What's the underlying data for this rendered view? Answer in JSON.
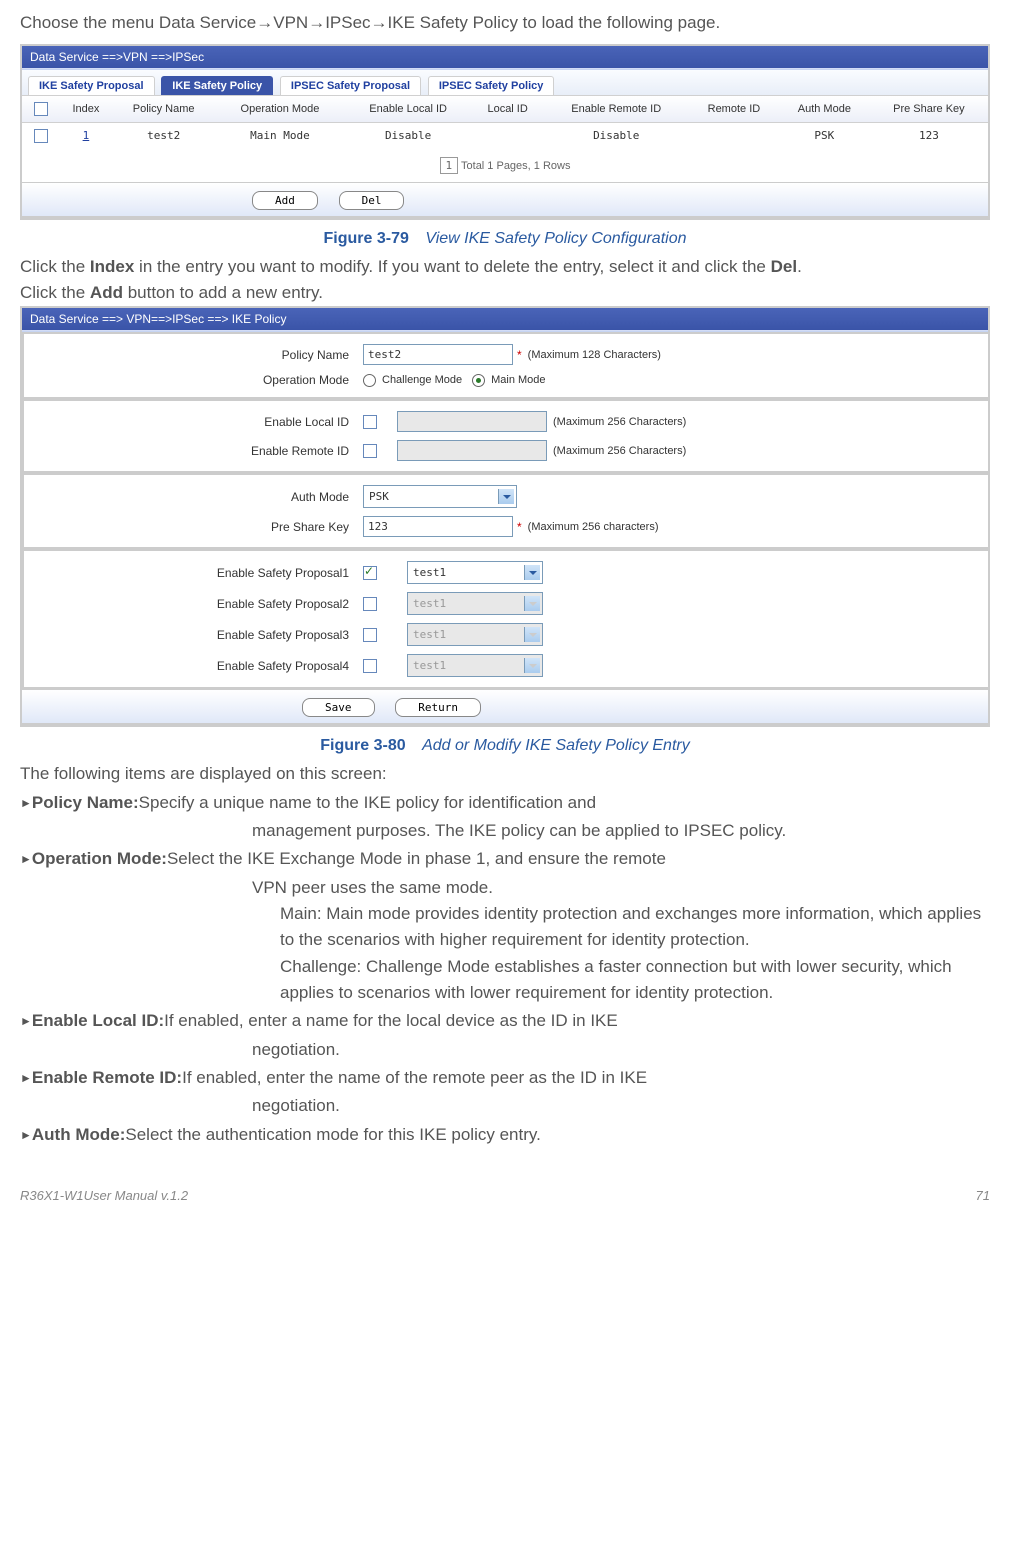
{
  "intro": "Choose the menu Data Service→VPN→IPSec→IKE Safety Policy to load the following page.",
  "fig1": {
    "breadcrumb": "Data Service ==>VPN ==>IPSec",
    "tabs": [
      "IKE Safety Proposal",
      "IKE Safety Policy",
      "IPSEC Safety Proposal",
      "IPSEC Safety Policy"
    ],
    "headers": [
      "Index",
      "Policy Name",
      "Operation Mode",
      "Enable Local ID",
      "Local ID",
      "Enable Remote ID",
      "Remote ID",
      "Auth Mode",
      "Pre Share Key"
    ],
    "row": {
      "index": "1",
      "policy": "test2",
      "mode": "Main Mode",
      "enLocal": "Disable",
      "localId": "",
      "enRemote": "Disable",
      "remoteId": "",
      "auth": "PSK",
      "psk": "123"
    },
    "pagination_page": "1",
    "pagination_text": "Total 1 Pages, 1 Rows",
    "btn_add": "Add",
    "btn_del": "Del"
  },
  "fig1_caption_num": "Figure 3-79",
  "fig1_caption_title": "View IKE Safety Policy Configuration",
  "para1_a": "Click the ",
  "para1_b": "Index",
  "para1_c": " in the entry you want to modify. If you want to delete the entry, select it and click the ",
  "para1_d": "Del",
  "para1_e": ".",
  "para2_a": "Click the ",
  "para2_b": "Add",
  "para2_c": " button to add a new entry.",
  "fig2": {
    "breadcrumb": "Data Service ==> VPN==>IPSec ==> IKE Policy",
    "l_policy": "Policy Name",
    "v_policy": "test2",
    "h_policy": "(Maximum 128 Characters)",
    "l_opmode": "Operation Mode",
    "radio_challenge": "Challenge Mode",
    "radio_main": "Main Mode",
    "l_enLocal": "Enable Local ID",
    "h_local": "(Maximum 256 Characters)",
    "l_enRemote": "Enable Remote ID",
    "h_remote": "(Maximum 256 Characters)",
    "l_auth": "Auth Mode",
    "v_auth": "PSK",
    "l_psk": "Pre Share Key",
    "v_psk": "123",
    "h_psk": "(Maximum 256 characters)",
    "l_sp1": "Enable Safety Proposal1",
    "l_sp2": "Enable Safety Proposal2",
    "l_sp3": "Enable Safety Proposal3",
    "l_sp4": "Enable Safety Proposal4",
    "dd_test": "test1",
    "btn_save": "Save",
    "btn_return": "Return"
  },
  "fig2_caption_num": "Figure 3-80",
  "fig2_caption_title": "Add or Modify IKE Safety Policy Entry",
  "items_intro": "The following items are displayed on this screen:",
  "it_policy_lbl": "Policy Name:",
  "it_policy_txt": "Specify a unique name to the IKE policy for identification and management purposes. The IKE policy can be applied to IPSEC policy.",
  "it_op_lbl": "Operation Mode:",
  "it_op_txt": "Select the IKE Exchange Mode in phase 1, and ensure the remote VPN peer uses the same mode.",
  "it_main_lbl": "Main:",
  "it_main_txt": " Main mode provides identity protection and exchanges more information, which applies to the scenarios with higher requirement for identity protection.",
  "it_chal_lbl": "Challenge:",
  "it_chal_txt": " Challenge Mode establishes a faster connection but with lower security, which applies to scenarios with lower requirement for identity protection.",
  "it_enlocal_lbl": "Enable Local ID:",
  "it_enlocal_txt": "If enabled, enter a name for the local device as the ID in IKE negotiation.",
  "it_enremote_lbl": "Enable Remote ID:",
  "it_enremote_txt": "If enabled, enter the name of the remote peer as the ID in IKE negotiation.",
  "it_auth_lbl": "Auth Mode:",
  "it_auth_txt": "Select the authentication mode for this IKE policy entry.",
  "footer_left": "R36X1-W1User Manual v.1.2",
  "footer_right": "71"
}
